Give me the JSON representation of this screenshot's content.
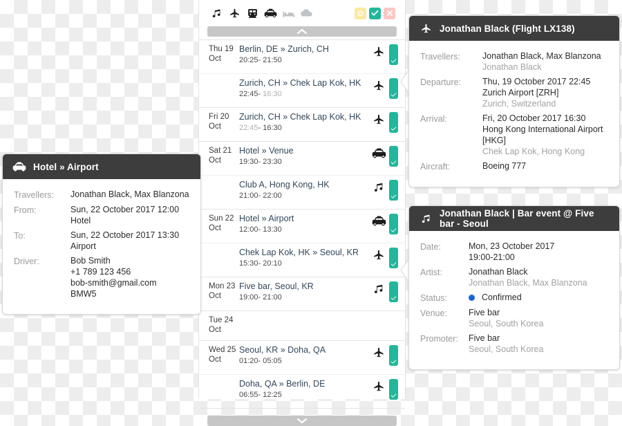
{
  "timeline": {
    "type_filters": [
      {
        "name": "music-note-icon",
        "label": "Music",
        "active": true
      },
      {
        "name": "airplane-icon",
        "label": "Flight",
        "active": true
      },
      {
        "name": "train-icon",
        "label": "Train",
        "active": true
      },
      {
        "name": "taxi-icon",
        "label": "Ground transfer",
        "active": true
      },
      {
        "name": "bed-icon",
        "label": "Hotel",
        "active": false
      },
      {
        "name": "cloud-icon",
        "label": "Other",
        "active": false
      }
    ],
    "status_filters": [
      {
        "name": "status-pending-button",
        "label": "Pending",
        "color": "#fbe9a0"
      },
      {
        "name": "status-confirmed-button",
        "label": "Confirmed",
        "color": "#22b79a"
      },
      {
        "name": "status-cancelled-button",
        "label": "Cancelled",
        "color": "#fbc7c3"
      }
    ],
    "scroll_up_label": "▲",
    "scroll_down_label": "▼",
    "days": [
      {
        "date_line1": "Thu 19",
        "date_line2": "Oct",
        "rows": [
          {
            "title": "Berlin, DE » Zurich, CH",
            "start": "20:25",
            "end": "21:50",
            "end_dim": false,
            "icon": "airplane-icon",
            "status": "confirmed"
          },
          {
            "title": "Zurich, CH » Chek Lap Kok, HK",
            "start": "22:45",
            "end": "16:30",
            "end_dim": true,
            "icon": "airplane-icon",
            "status": "confirmed"
          }
        ]
      },
      {
        "date_line1": "Fri 20",
        "date_line2": "Oct",
        "rows": [
          {
            "title": "Zurich, CH » Chek Lap Kok, HK",
            "start": "22:45",
            "end": "16:30",
            "start_dim": true,
            "end_dim": false,
            "icon": "airplane-icon",
            "status": "confirmed"
          }
        ]
      },
      {
        "date_line1": "Sat 21",
        "date_line2": "Oct",
        "rows": [
          {
            "title": "Hotel » Venue",
            "start": "19:30",
            "end": "23:30",
            "end_dim": false,
            "icon": "taxi-icon",
            "status": "confirmed"
          },
          {
            "title": "Club A, Hong Kong, HK",
            "start": "21:00",
            "end": "22:00",
            "end_dim": false,
            "icon": "music-note-icon",
            "status": "confirmed"
          }
        ]
      },
      {
        "date_line1": "Sun 22",
        "date_line2": "Oct",
        "rows": [
          {
            "title": "Hotel » Airport",
            "start": "12:00",
            "end": "13:30",
            "end_dim": false,
            "icon": "taxi-icon",
            "status": "confirmed"
          },
          {
            "title": "Chek Lap Kok, HK » Seoul, KR",
            "start": "15:30",
            "end": "20:10",
            "end_dim": false,
            "icon": "airplane-icon",
            "status": "confirmed"
          }
        ]
      },
      {
        "date_line1": "Mon 23",
        "date_line2": "Oct",
        "rows": [
          {
            "title": "Five bar, Seoul, KR",
            "start": "19:00",
            "end": "21:00",
            "end_dim": false,
            "icon": "music-note-icon",
            "status": "confirmed"
          }
        ]
      },
      {
        "date_line1": "Tue 24",
        "date_line2": "Oct",
        "rows": [
          {
            "title": "",
            "start": "",
            "end": "",
            "icon": "",
            "status": "none",
            "empty": true
          }
        ]
      },
      {
        "date_line1": "Wed 25",
        "date_line2": "Oct",
        "rows": [
          {
            "title": "Seoul, KR » Doha, QA",
            "start": "01:20",
            "end": "05:05",
            "end_dim": false,
            "icon": "airplane-icon",
            "status": "confirmed"
          },
          {
            "title": "Doha, QA » Berlin, DE",
            "start": "06:55",
            "end": "12:25",
            "end_dim": false,
            "icon": "airplane-icon",
            "status": "confirmed"
          }
        ]
      }
    ]
  },
  "transfer_card": {
    "header_icon": "taxi-icon",
    "title": "Hotel » Airport",
    "fields": [
      {
        "label": "Travellers:",
        "values": [
          {
            "text": "Jonathan Black, Max Blanzona",
            "style": "normal"
          }
        ]
      },
      {
        "label": "From:",
        "values": [
          {
            "text": "Sun, 22 October 2017 12:00",
            "style": "normal"
          },
          {
            "text": "Hotel",
            "style": "normal"
          }
        ]
      },
      {
        "label": "To:",
        "values": [
          {
            "text": "Sun, 22 October 2017 13:30",
            "style": "normal"
          },
          {
            "text": "Airport",
            "style": "normal"
          }
        ]
      },
      {
        "label": "Driver:",
        "values": [
          {
            "text": "Bob Smith",
            "style": "normal"
          },
          {
            "text": "+1 789 123 456",
            "style": "normal"
          },
          {
            "text": "bob-smith@gmail.com",
            "style": "normal"
          },
          {
            "text": "BMW5",
            "style": "normal"
          }
        ]
      }
    ]
  },
  "flight_card": {
    "header_icon": "airplane-icon",
    "title": "Jonathan Black (Flight LX138)",
    "fields": [
      {
        "label": "Travellers:",
        "values": [
          {
            "text": "Jonathan Black, Max Blanzona",
            "style": "normal"
          },
          {
            "text": "Jonathan Black",
            "style": "muted"
          }
        ]
      },
      {
        "label": "Departure:",
        "values": [
          {
            "text": "Thu, 19 October 2017 22:45",
            "style": "normal"
          },
          {
            "text": "Zurich Airport [ZRH]",
            "style": "normal"
          },
          {
            "text": "Zurich, Switzerland",
            "style": "muted"
          }
        ]
      },
      {
        "label": "Arrival:",
        "values": [
          {
            "text": "Fri, 20 October 2017 16:30",
            "style": "normal"
          },
          {
            "text": "Hong Kong International Airport [HKG]",
            "style": "normal"
          },
          {
            "text": "Chek Lap Kok, Hong Kong",
            "style": "muted"
          }
        ]
      },
      {
        "label": "Aircraft:",
        "values": [
          {
            "text": "Boeing 777",
            "style": "normal"
          }
        ]
      }
    ]
  },
  "event_card": {
    "header_icon": "music-note-icon",
    "title": "Jonathan Black | Bar event @ Five bar - Seoul",
    "status_label": "Confirmed",
    "status_color": "#1565d8",
    "fields": [
      {
        "label": "Date:",
        "values": [
          {
            "text": "Mon, 23 October 2017",
            "style": "normal"
          },
          {
            "text": "19:00-21:00",
            "style": "normal"
          }
        ]
      },
      {
        "label": "Artist:",
        "values": [
          {
            "text": "Jonathan Black",
            "style": "normal"
          },
          {
            "text": "Jonathan Black, Max Blanzona",
            "style": "muted"
          }
        ]
      },
      {
        "label": "Status:",
        "values": [],
        "is_status": true
      },
      {
        "label": "Venue:",
        "values": [
          {
            "text": "Five bar",
            "style": "normal"
          },
          {
            "text": "Seoul, South Korea",
            "style": "muted"
          }
        ]
      },
      {
        "label": "Promoter:",
        "values": [
          {
            "text": "Five bar",
            "style": "normal"
          },
          {
            "text": "Seoul, South Korea",
            "style": "muted"
          }
        ]
      }
    ]
  }
}
